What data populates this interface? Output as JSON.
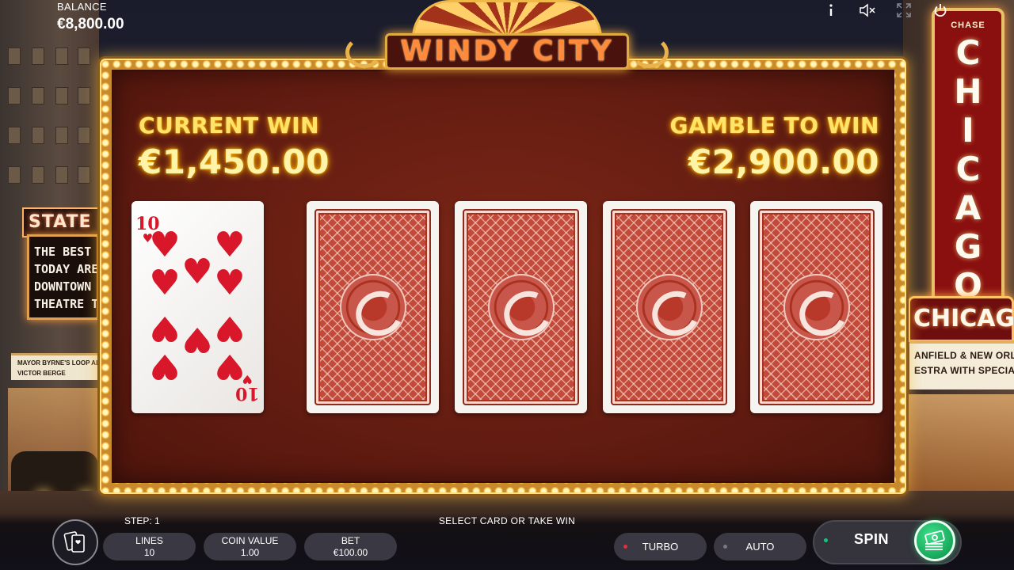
{
  "game": {
    "title": "WINDY CITY"
  },
  "hud": {
    "balance_label": "BALANCE",
    "balance_value": "€8,800.00",
    "icons": [
      "info-icon",
      "sound-muted-icon",
      "fullscreen-icon",
      "power-icon"
    ]
  },
  "gamble": {
    "current_win_label": "CURRENT WIN",
    "current_win_value": "€1,450.00",
    "gamble_to_win_label": "GAMBLE TO WIN",
    "gamble_to_win_value": "€2,900.00",
    "dealer_card": {
      "rank": "10",
      "suit": "hearts",
      "suit_glyph": "♥",
      "color": "#d8182a"
    },
    "hidden_cards": 4
  },
  "bottom": {
    "step_label": "STEP: 1",
    "prompt": "SELECT CARD OR TAKE WIN",
    "lines_label": "LINES",
    "lines_value": "10",
    "coin_value_label": "COIN VALUE",
    "coin_value_value": "1.00",
    "bet_label": "BET",
    "bet_value": "€100.00",
    "turbo_label": "TURBO",
    "auto_label": "AUTO",
    "spin_label": "SPIN",
    "turbo_indicator_color": "#e0303a",
    "auto_indicator_color": "#7a7882"
  },
  "background": {
    "left_sign": "STATE L",
    "left_marquee_lines": [
      "THE BEST",
      "TODAY ARE",
      "DOWNTOWN",
      "THEATRE T"
    ],
    "left_strip_lines": [
      "MAYOR BYRNE'S LOOP ALI",
      "VICTOR BERGE"
    ],
    "right_tower_top": "CHASE",
    "right_tower_letters": [
      "C",
      "H",
      "I",
      "C",
      "A",
      "G",
      "O"
    ],
    "right_horizontal": "CHICAGO",
    "right_marquee_lines": [
      "ANFIELD & NEW ORLEANS JAZZ",
      "ESTRA WITH SPECIAL GUESTS"
    ]
  },
  "colors": {
    "accent_gold": "#ffe36a",
    "panel_red": "#5e1a10",
    "card_back_red": "#c24a3a",
    "spin_green": "#18a85a"
  }
}
